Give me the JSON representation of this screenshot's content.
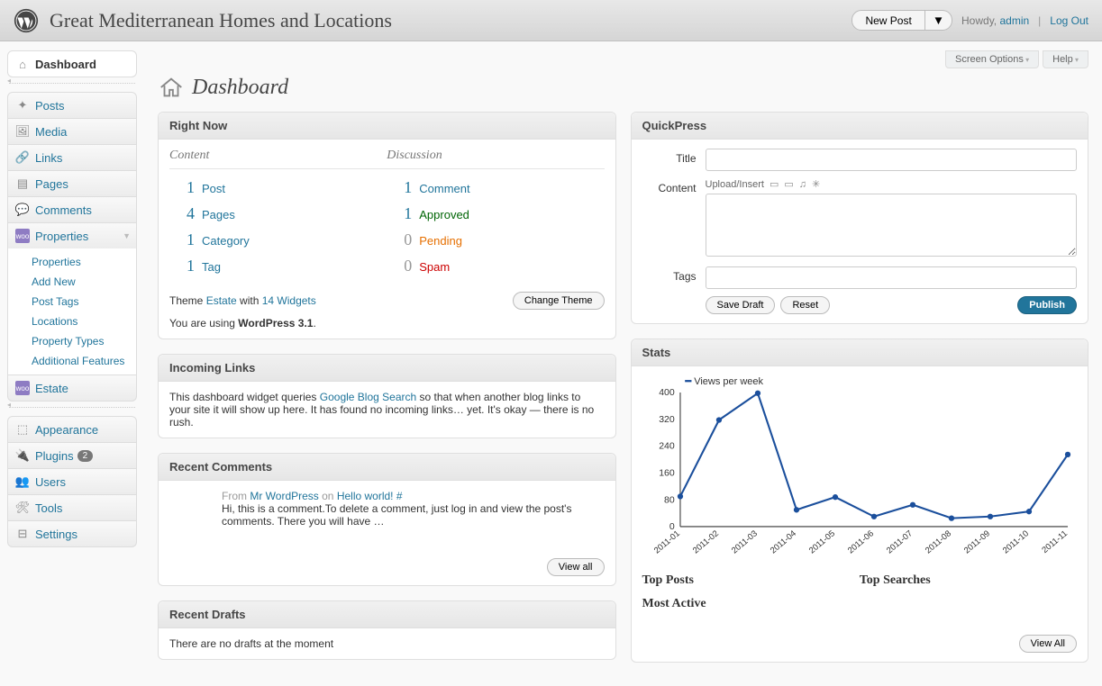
{
  "topbar": {
    "site_title": "Great Mediterranean Homes and Locations",
    "new_post": "New Post",
    "howdy": "Howdy,",
    "user": "admin",
    "logout": "Log Out"
  },
  "tabs": {
    "screen_options": "Screen Options",
    "help": "Help"
  },
  "page_title": "Dashboard",
  "sidebar": {
    "dashboard": "Dashboard",
    "posts": "Posts",
    "media": "Media",
    "links": "Links",
    "pages": "Pages",
    "comments": "Comments",
    "properties": "Properties",
    "properties_sub": [
      "Properties",
      "Add New",
      "Post Tags",
      "Locations",
      "Property Types",
      "Additional Features"
    ],
    "estate": "Estate",
    "appearance": "Appearance",
    "plugins": "Plugins",
    "plugins_count": "2",
    "users": "Users",
    "tools": "Tools",
    "settings": "Settings"
  },
  "right_now": {
    "title": "Right Now",
    "content_head": "Content",
    "discussion_head": "Discussion",
    "content": [
      {
        "num": "1",
        "label": "Post"
      },
      {
        "num": "4",
        "label": "Pages"
      },
      {
        "num": "1",
        "label": "Category"
      },
      {
        "num": "1",
        "label": "Tag"
      }
    ],
    "discussion": [
      {
        "num": "1",
        "label": "Comment",
        "cls": ""
      },
      {
        "num": "1",
        "label": "Approved",
        "cls": "approved"
      },
      {
        "num": "0",
        "label": "Pending",
        "cls": "pending"
      },
      {
        "num": "0",
        "label": "Spam",
        "cls": "spam"
      }
    ],
    "theme_prefix": "Theme ",
    "theme_name": "Estate",
    "theme_mid": " with ",
    "widgets": "14 Widgets",
    "change_theme": "Change Theme",
    "version_prefix": "You are using ",
    "version": "WordPress 3.1",
    "version_suffix": "."
  },
  "incoming": {
    "title": "Incoming Links",
    "text_before": "This dashboard widget queries ",
    "link": "Google Blog Search",
    "text_after": " so that when another blog links to your site it will show up here. It has found no incoming links… yet. It's okay — there is no rush."
  },
  "recent_comments": {
    "title": "Recent Comments",
    "from": "From ",
    "author": "Mr WordPress",
    "on": " on ",
    "post": "Hello world!",
    "hash": " #",
    "body": "Hi, this is a comment.To delete a comment, just log in and view the post's comments. There you will have …",
    "view_all": "View all"
  },
  "recent_drafts": {
    "title": "Recent Drafts",
    "text": "There are no drafts at the moment"
  },
  "quickpress": {
    "title": "QuickPress",
    "label_title": "Title",
    "label_content": "Content",
    "label_tags": "Tags",
    "upload_insert": "Upload/Insert",
    "save_draft": "Save Draft",
    "reset": "Reset",
    "publish": "Publish"
  },
  "stats": {
    "title": "Stats",
    "legend": "Views per week",
    "top_posts": "Top Posts",
    "top_searches": "Top Searches",
    "most_active": "Most Active",
    "view_all": "View All"
  },
  "chart_data": {
    "type": "line",
    "title": "",
    "xlabel": "",
    "ylabel": "",
    "ylim": [
      0,
      400
    ],
    "y_ticks": [
      0,
      80,
      160,
      240,
      320,
      400
    ],
    "categories": [
      "2011-01",
      "2011-02",
      "2011-03",
      "2011-04",
      "2011-05",
      "2011-06",
      "2011-07",
      "2011-08",
      "2011-09",
      "2011-10",
      "2011-11"
    ],
    "series": [
      {
        "name": "Views per week",
        "values": [
          90,
          318,
          398,
          50,
          88,
          30,
          65,
          25,
          30,
          45,
          215
        ]
      }
    ]
  }
}
